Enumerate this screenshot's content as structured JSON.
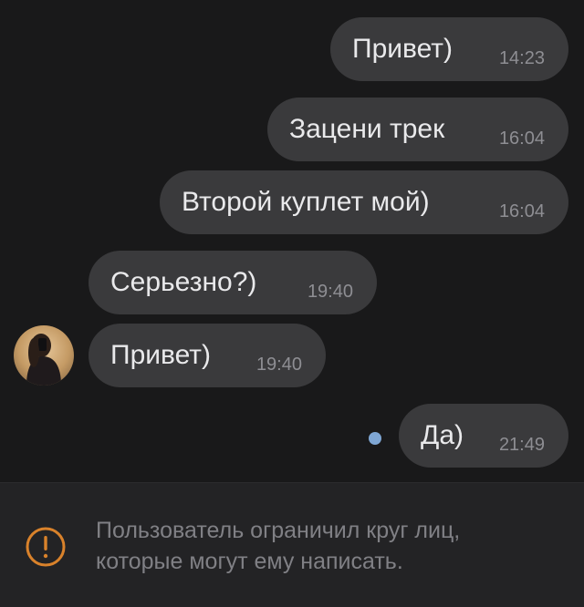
{
  "messages": [
    {
      "text": "Привет)",
      "time": "14:23",
      "direction": "outgoing"
    },
    {
      "text": "Зацени трек",
      "time": "16:04",
      "direction": "outgoing"
    },
    {
      "text": "Второй куплет мой)",
      "time": "16:04",
      "direction": "outgoing"
    },
    {
      "text": "Серьезно?)",
      "time": "19:40",
      "direction": "incoming"
    },
    {
      "text": "Привет)",
      "time": "19:40",
      "direction": "incoming"
    },
    {
      "text": "Да)",
      "time": "21:49",
      "direction": "outgoing",
      "unread": true
    }
  ],
  "restriction": {
    "text": "Пользователь ограничил круг лиц, которые могут ему написать.",
    "icon": "warning-circle-icon",
    "icon_color": "#d9822b"
  },
  "colors": {
    "background": "#19191a",
    "bubble": "#3a3a3c",
    "unread_dot": "#7fa7d4"
  }
}
